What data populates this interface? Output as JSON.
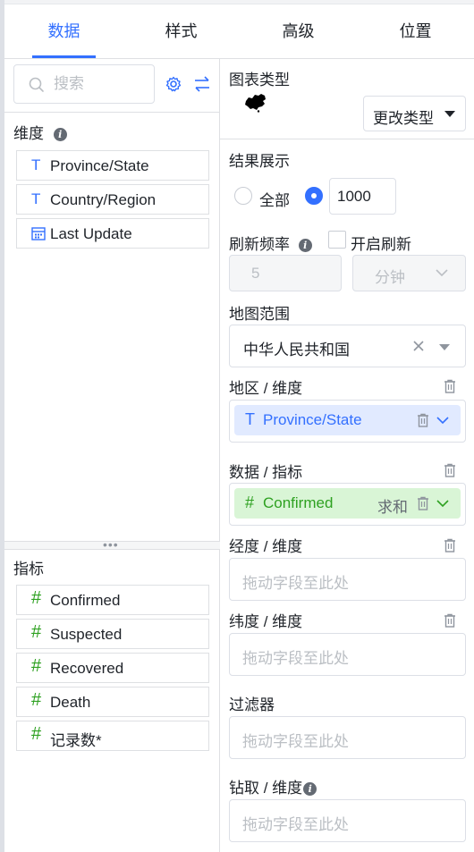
{
  "tabs": [
    {
      "label": "数据",
      "active": true
    },
    {
      "label": "样式",
      "active": false
    },
    {
      "label": "高级",
      "active": false
    },
    {
      "label": "位置",
      "active": false
    }
  ],
  "left": {
    "search_placeholder": "搜索",
    "dimensions_title": "维度",
    "dimensions": [
      {
        "type": "text",
        "label": "Province/State"
      },
      {
        "type": "text",
        "label": "Country/Region"
      },
      {
        "type": "date",
        "label": "Last Update"
      }
    ],
    "measures_title": "指标",
    "measures": [
      {
        "type": "number",
        "label": "Confirmed"
      },
      {
        "type": "number",
        "label": "Suspected"
      },
      {
        "type": "number",
        "label": "Recovered"
      },
      {
        "type": "number",
        "label": "Death"
      },
      {
        "type": "number",
        "label": "记录数*"
      }
    ]
  },
  "right": {
    "chart_type_title": "图表类型",
    "change_type_label": "更改类型",
    "result_title": "结果展示",
    "radio_all_label": "全部",
    "limit_value": "1000",
    "refresh_title": "刷新频率",
    "refresh_toggle_label": "开启刷新",
    "refresh_interval_value": "5",
    "refresh_unit": "分钟",
    "map_range_title": "地图范围",
    "map_range_value": "中华人民共和国",
    "area_title": "地区 / 维度",
    "area_field": "Province/State",
    "data_title": "数据 / 指标",
    "data_field": "Confirmed",
    "data_agg": "求和",
    "lon_title": "经度 / 维度",
    "lat_title": "纬度 / 维度",
    "filter_title": "过滤器",
    "drill_title": "钻取 / 维度",
    "drop_placeholder": "拖动字段至此处"
  },
  "colors": {
    "accent": "#3370ff",
    "measure": "#2ea121",
    "border": "#dcdfe6"
  }
}
